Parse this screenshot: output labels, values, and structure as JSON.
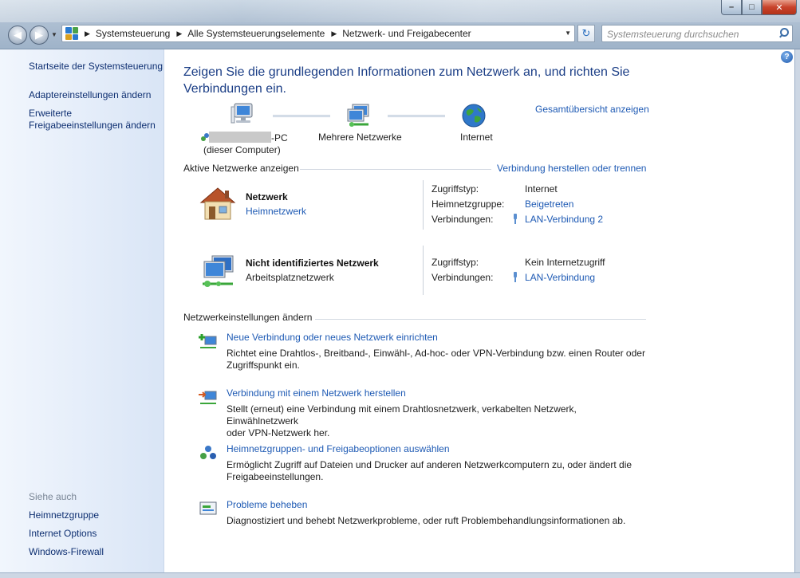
{
  "window": {
    "controls": {
      "minimize": "–",
      "maximize": "□",
      "close": "✕"
    }
  },
  "address": {
    "crumbs": [
      "Systemsteuerung",
      "Alle Systemsteuerungselemente",
      "Netzwerk- und Freigabecenter"
    ],
    "search_placeholder": "Systemsteuerung durchsuchen"
  },
  "sidebar": {
    "home_link": "Startseite der Systemsteuerung",
    "links": [
      "Adaptereinstellungen ändern",
      "Erweiterte",
      "Freigabeeinstellungen ändern"
    ],
    "see_also_heading": "Siehe auch",
    "see_also": [
      "Heimnetzgruppe",
      "Internet Options",
      "Windows-Firewall"
    ]
  },
  "main": {
    "title_line1": "Zeigen Sie die grundlegenden Informationen zum Netzwerk an, und richten Sie",
    "title_line2": "Verbindungen ein.",
    "full_map_link": "Gesamtübersicht anzeigen",
    "map": {
      "computer_suffix": "-PC",
      "computer_note": "(dieser Computer)",
      "networks_label": "Mehrere Netzwerke",
      "internet_label": "Internet"
    },
    "active_networks": {
      "heading": "Aktive Netzwerke anzeigen",
      "connect_link": "Verbindung herstellen oder trennen",
      "networks": [
        {
          "name": "Netzwerk",
          "type": "Heimnetzwerk",
          "rows": [
            {
              "key": "Zugriffstyp:",
              "value": "Internet"
            },
            {
              "key": "Heimnetzgruppe:",
              "value": "Beigetreten"
            },
            {
              "key": "Verbindungen:",
              "value": "LAN-Verbindung 2"
            }
          ]
        },
        {
          "name": "Nicht identifiziertes Netzwerk",
          "type": "Arbeitsplatznetzwerk",
          "rows": [
            {
              "key": "Zugriffstyp:",
              "value": "Kein Internetzugriff"
            },
            {
              "key": "Verbindungen:",
              "value": "LAN-Verbindung"
            }
          ]
        }
      ]
    },
    "change_settings": {
      "heading": "Netzwerkeinstellungen ändern",
      "tasks": [
        {
          "title": "Neue Verbindung oder neues Netzwerk einrichten",
          "desc1": "Richtet eine Drahtlos-, Breitband-, Einwähl-, Ad-hoc- oder VPN-Verbindung bzw. einen Router oder",
          "desc2": "Zugriffspunkt ein."
        },
        {
          "title": "Verbindung mit einem Netzwerk herstellen",
          "desc1": "Stellt (erneut) eine Verbindung mit einem Drahtlosnetzwerk, verkabelten Netzwerk, Einwählnetzwerk",
          "desc2": "oder VPN-Netzwerk her."
        },
        {
          "title": "Heimnetzgruppen- und Freigabeoptionen auswählen",
          "desc1": "Ermöglicht Zugriff auf Dateien und Drucker auf anderen Netzwerkcomputern zu, oder ändert die",
          "desc2": "Freigabeeinstellungen."
        },
        {
          "title": "Probleme beheben",
          "desc1": "Diagnostiziert und behebt Netzwerkprobleme, oder ruft Problembehandlungsinformationen ab.",
          "desc2": ""
        }
      ]
    }
  },
  "colors": {
    "link": "#1e5ab4",
    "title": "#1b3e86",
    "sidebar_link": "#0e2f71"
  }
}
